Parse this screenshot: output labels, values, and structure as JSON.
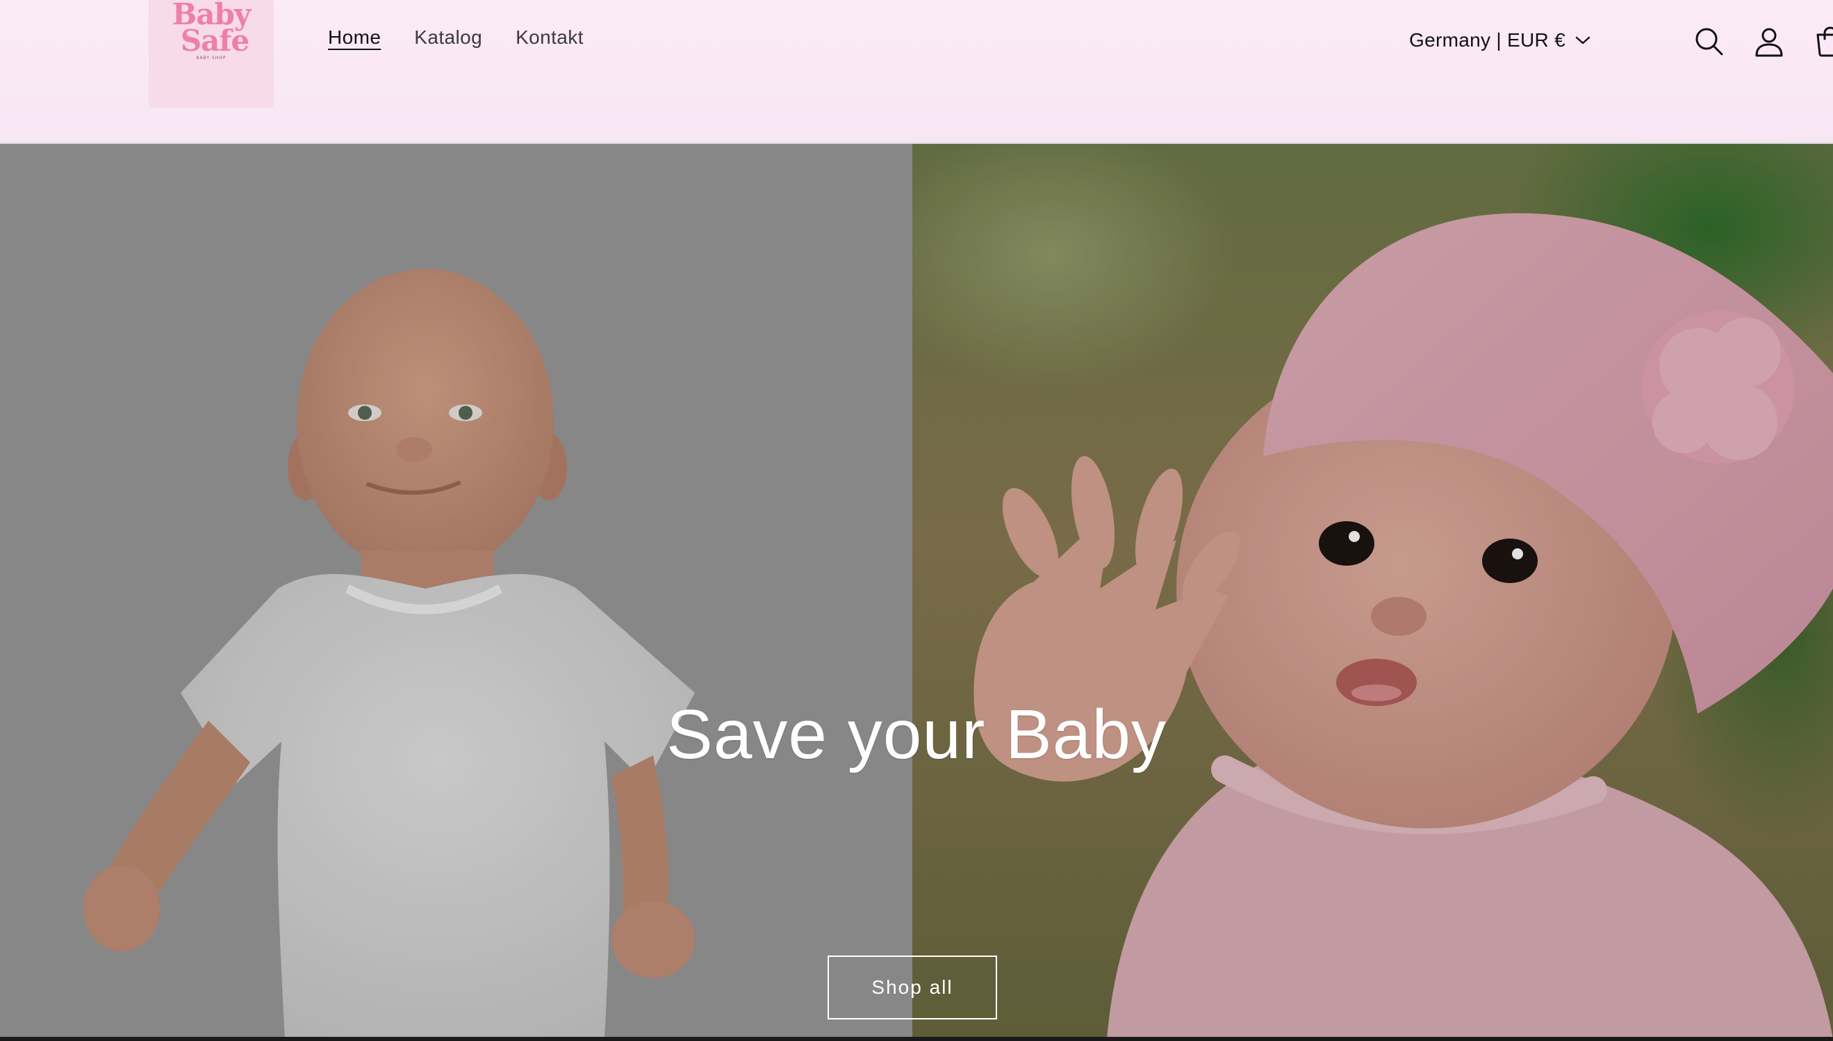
{
  "colors": {
    "header_bg": "#fbeaf7",
    "logo_pink": "#ee7fa6",
    "text_dark": "#121212",
    "hero_text": "#ffffff"
  },
  "logo": {
    "line1": "Baby",
    "line2": "Safe",
    "tagline": "BABY SHOP"
  },
  "nav": {
    "items": [
      {
        "label": "Home",
        "active": true
      },
      {
        "label": "Katalog",
        "active": false
      },
      {
        "label": "Kontakt",
        "active": false
      }
    ]
  },
  "header": {
    "country_label": "Germany | EUR €",
    "icons": {
      "dropdown": "chevron-down-icon",
      "search": "search-icon",
      "account": "account-icon",
      "cart": "cart-icon"
    }
  },
  "hero": {
    "title": "Save your Baby",
    "button_label": "Shop all",
    "left_image": "baby-in-white-bodysuit",
    "right_image": "baby-in-pink-hat"
  }
}
